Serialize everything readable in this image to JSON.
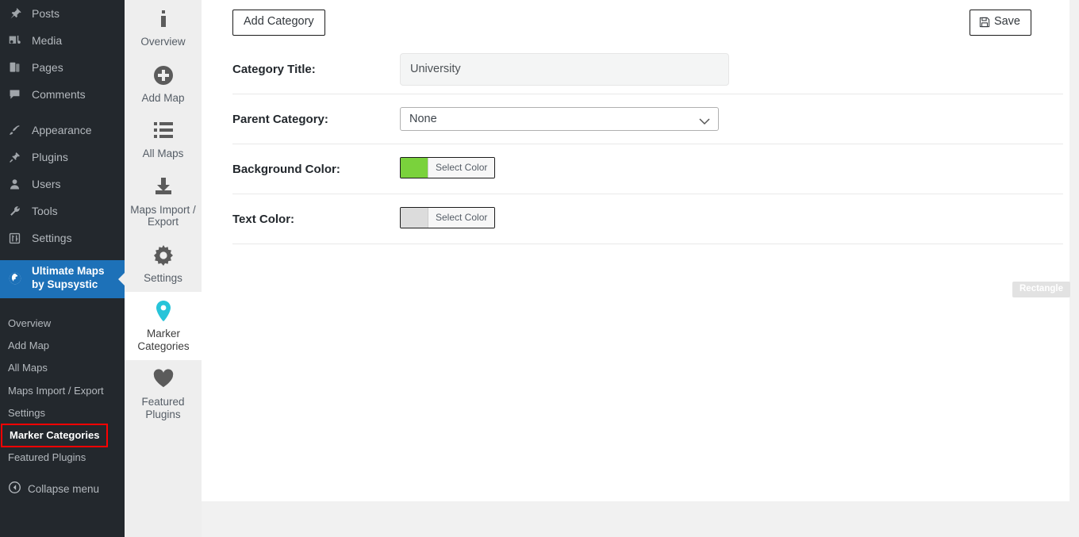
{
  "wp_sidebar": {
    "items": [
      {
        "label": "Posts",
        "icon": "pin-icon"
      },
      {
        "label": "Media",
        "icon": "media-icon"
      },
      {
        "label": "Pages",
        "icon": "pages-icon"
      },
      {
        "label": "Comments",
        "icon": "comments-icon"
      },
      {
        "label": "Appearance",
        "icon": "brush-icon"
      },
      {
        "label": "Plugins",
        "icon": "plug-icon"
      },
      {
        "label": "Users",
        "icon": "user-icon"
      },
      {
        "label": "Tools",
        "icon": "wrench-icon"
      },
      {
        "label": "Settings",
        "icon": "sliders-icon"
      }
    ],
    "active_plugin": {
      "label": "Ultimate Maps by Supsystic",
      "icon": "globe-icon",
      "accent": "#1d71b8"
    },
    "submenu": [
      {
        "label": "Overview",
        "current": false
      },
      {
        "label": "Add Map",
        "current": false
      },
      {
        "label": "All Maps",
        "current": false
      },
      {
        "label": "Maps Import / Export",
        "current": false
      },
      {
        "label": "Settings",
        "current": false
      },
      {
        "label": "Marker Categories",
        "current": true
      },
      {
        "label": "Featured Plugins",
        "current": false
      }
    ],
    "collapse": {
      "label": "Collapse menu",
      "icon": "collapse-arrow-icon"
    },
    "highlight_color": "#ff0000"
  },
  "tab_strip": {
    "tabs": [
      {
        "label": "Overview",
        "icon": "info-icon",
        "active": false
      },
      {
        "label": "Add Map",
        "icon": "plus-circle-icon",
        "active": false
      },
      {
        "label": "All Maps",
        "icon": "list-icon",
        "active": false
      },
      {
        "label": "Maps Import / Export",
        "icon": "download-icon",
        "active": false
      },
      {
        "label": "Settings",
        "icon": "gear-icon",
        "active": false
      },
      {
        "label": "Marker Categories",
        "icon": "map-pin-icon",
        "active": true
      },
      {
        "label": "Featured Plugins",
        "icon": "heart-icon",
        "active": false
      }
    ],
    "active_icon_color": "#27c4d9"
  },
  "toolbar": {
    "add_category_label": "Add Category",
    "save_label": "Save",
    "save_icon": "floppy-disk-icon"
  },
  "form": {
    "rows": [
      {
        "label": "Category Title:"
      },
      {
        "label": "Parent Category:"
      },
      {
        "label": "Background Color:"
      },
      {
        "label": "Text Color:"
      }
    ],
    "category_title": {
      "value": "University",
      "placeholder": ""
    },
    "parent_category": {
      "selected": "None",
      "options": [
        "None"
      ],
      "chevron_icon": "chevron-down-icon"
    },
    "background_color": {
      "button_label": "Select Color",
      "value": "#7ad23c"
    },
    "text_color": {
      "button_label": "Select Color",
      "value": "#dcdcdc"
    }
  },
  "overlay": {
    "rectangle_tooltip": "Rectangle"
  }
}
